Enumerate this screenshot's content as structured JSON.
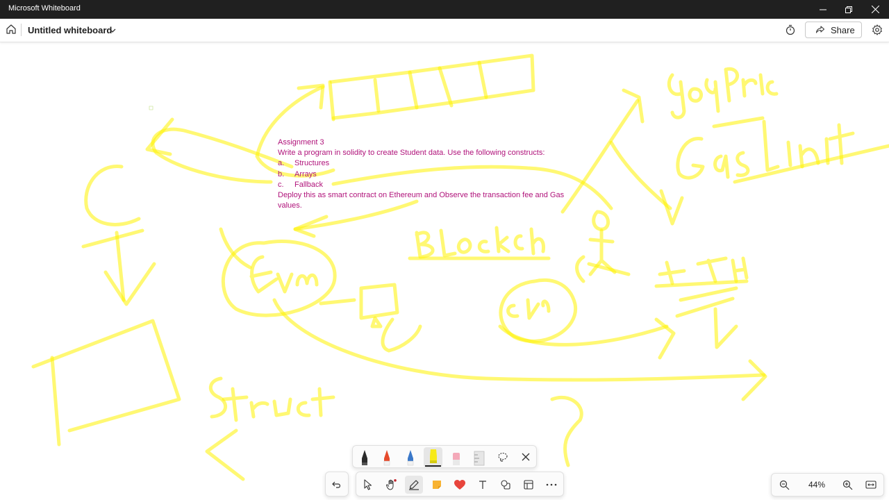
{
  "window": {
    "title": "Microsoft Whiteboard"
  },
  "header": {
    "board_title": "Untitled whiteboard",
    "share_label": "Share"
  },
  "note": {
    "heading": "Assignment 3",
    "intro": "Write a program in solidity to create Student data. Use the following constructs:",
    "items": [
      {
        "letter": "a.",
        "text": "Structures"
      },
      {
        "letter": "b.",
        "text": "Arrays"
      },
      {
        "letter": "c.",
        "text": "Fallback"
      }
    ],
    "outro_line1": "Deploy this as smart contract on Ethereum and Observe the transaction fee and Gas",
    "outro_line2": "values."
  },
  "zoom": {
    "value": "44%"
  },
  "colors": {
    "highlighter": "#fff200",
    "note_text": "#b0127a",
    "titlebar": "#202020"
  },
  "icons": {
    "header": [
      "home-icon",
      "chevron-down-icon",
      "timer-icon",
      "share-icon",
      "settings-icon"
    ],
    "pens": [
      "black-pen-icon",
      "red-pen-icon",
      "blue-pen-icon",
      "yellow-highlighter-icon",
      "eraser-icon",
      "ruler-icon",
      "lasso-icon",
      "close-icon"
    ],
    "tools": [
      "undo-icon",
      "select-icon",
      "hand-icon",
      "pen-icon",
      "sticky-note-icon",
      "reaction-heart-icon",
      "text-icon",
      "shapes-icon",
      "template-icon",
      "more-icon"
    ],
    "zoom": [
      "zoom-out-icon",
      "zoom-in-icon",
      "fit-to-screen-icon"
    ]
  }
}
